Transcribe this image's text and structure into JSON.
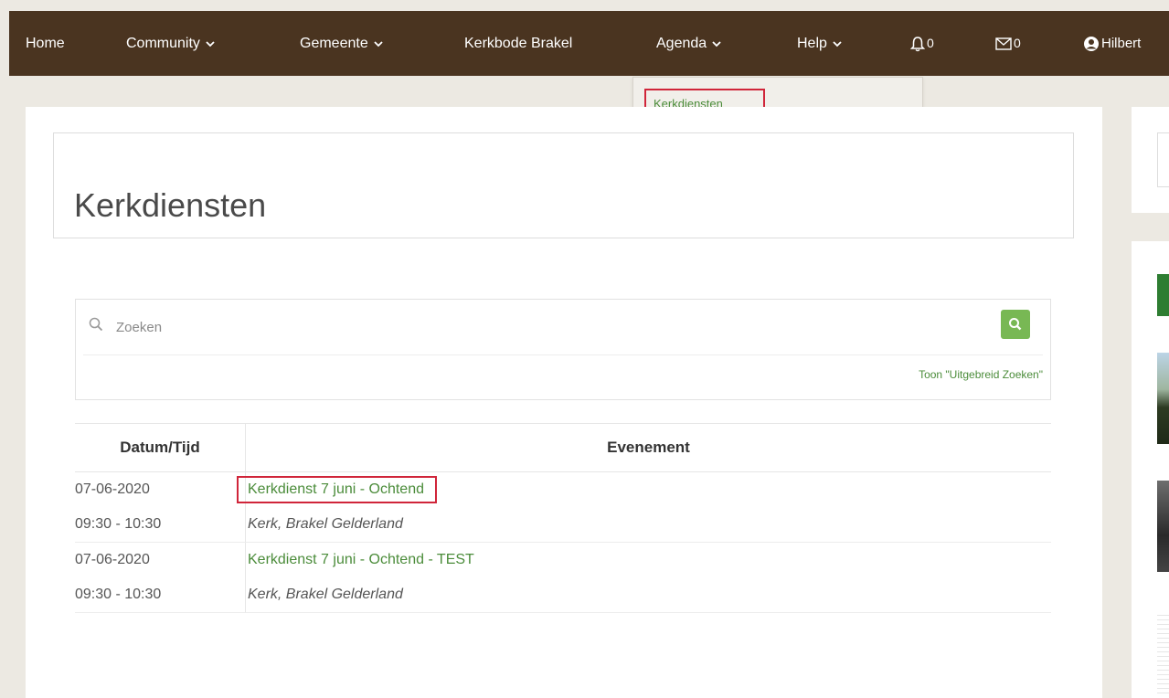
{
  "nav": {
    "items": [
      {
        "label": "Home",
        "dropdown": false
      },
      {
        "label": "Community",
        "dropdown": true
      },
      {
        "label": "Gemeente",
        "dropdown": true
      },
      {
        "label": "Kerkbode Brakel",
        "dropdown": false
      },
      {
        "label": "Agenda",
        "dropdown": true
      },
      {
        "label": "Help",
        "dropdown": true
      }
    ],
    "notifications_count": "0",
    "messages_count": "0",
    "user_name": "Hilbert",
    "icons": {
      "notifications": "bell-icon",
      "messages": "envelope-icon",
      "user": "user-icon"
    }
  },
  "agenda_dropdown": {
    "items": [
      {
        "label": "Kerkdiensten"
      }
    ]
  },
  "page": {
    "title": "Kerkdiensten"
  },
  "search": {
    "placeholder": "Zoeken",
    "advanced_label": "Toon \"Uitgebreid Zoeken\""
  },
  "table": {
    "headers": [
      "Datum/Tijd",
      "Evenement"
    ],
    "rows": [
      {
        "date": "07-06-2020",
        "time": "09:30 - 10:30",
        "title": "Kerkdienst 7 juni - Ochtend",
        "location": "Kerk, Brakel Gelderland"
      },
      {
        "date": "07-06-2020",
        "time": "09:30 - 10:30",
        "title": "Kerkdienst 7 juni - Ochtend - TEST",
        "location": "Kerk, Brakel Gelderland"
      }
    ]
  },
  "colors": {
    "nav_bg": "#4a3420",
    "link_green": "#4b8c3a",
    "search_button": "#78b854",
    "highlight_red": "#d0253a",
    "page_bg": "#ece9e2"
  }
}
